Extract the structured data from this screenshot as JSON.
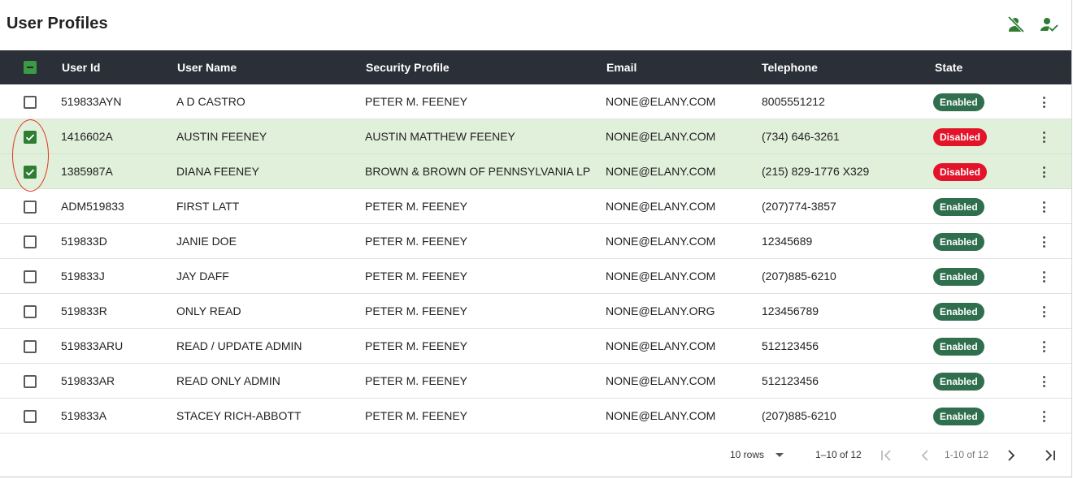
{
  "page": {
    "title": "User Profiles"
  },
  "toolbar": {
    "disable_icon": "person-off-icon",
    "enable_icon": "person-check-icon",
    "icon_color": "#2e7d32"
  },
  "table": {
    "header_bg": "#2b3038",
    "columns": [
      "User Id",
      "User Name",
      "Security Profile",
      "Email",
      "Telephone",
      "State"
    ],
    "rows": [
      {
        "user_id": "519833AYN",
        "user_name": "A D CASTRO",
        "security_profile": "PETER M. FEENEY",
        "email": "NONE@ELANY.COM",
        "telephone": "8005551212",
        "state": "Enabled",
        "selected": false
      },
      {
        "user_id": "1416602A",
        "user_name": "AUSTIN FEENEY",
        "security_profile": "AUSTIN MATTHEW FEENEY",
        "email": "NONE@ELANY.COM",
        "telephone": "(734) 646-3261",
        "state": "Disabled",
        "selected": true
      },
      {
        "user_id": "1385987A",
        "user_name": "DIANA FEENEY",
        "security_profile": "BROWN & BROWN OF PENNSYLVANIA LP",
        "email": "NONE@ELANY.COM",
        "telephone": "(215) 829-1776 X329",
        "state": "Disabled",
        "selected": true
      },
      {
        "user_id": "ADM519833",
        "user_name": "FIRST LATT",
        "security_profile": "PETER M. FEENEY",
        "email": "NONE@ELANY.COM",
        "telephone": "(207)774-3857",
        "state": "Enabled",
        "selected": false
      },
      {
        "user_id": "519833D",
        "user_name": "JANIE DOE",
        "security_profile": "PETER M. FEENEY",
        "email": "NONE@ELANY.COM",
        "telephone": "12345689",
        "state": "Enabled",
        "selected": false
      },
      {
        "user_id": "519833J",
        "user_name": "JAY DAFF",
        "security_profile": "PETER M. FEENEY",
        "email": "NONE@ELANY.COM",
        "telephone": "(207)885-6210",
        "state": "Enabled",
        "selected": false
      },
      {
        "user_id": "519833R",
        "user_name": "ONLY READ",
        "security_profile": "PETER M. FEENEY",
        "email": "NONE@ELANY.ORG",
        "telephone": "123456789",
        "state": "Enabled",
        "selected": false
      },
      {
        "user_id": "519833ARU",
        "user_name": "READ / UPDATE ADMIN",
        "security_profile": "PETER M. FEENEY",
        "email": "NONE@ELANY.COM",
        "telephone": "512123456",
        "state": "Enabled",
        "selected": false
      },
      {
        "user_id": "519833AR",
        "user_name": "READ ONLY ADMIN",
        "security_profile": "PETER M. FEENEY",
        "email": "NONE@ELANY.COM",
        "telephone": "512123456",
        "state": "Enabled",
        "selected": false
      },
      {
        "user_id": "519833A",
        "user_name": "STACEY RICH-ABBOTT",
        "security_profile": "PETER M. FEENEY",
        "email": "NONE@ELANY.COM",
        "telephone": "(207)885-6210",
        "state": "Enabled",
        "selected": false
      }
    ],
    "state_colors": {
      "Enabled": "#2f6f4e",
      "Disabled": "#e3132a"
    },
    "selected_row_color": "#e1f0db",
    "row_menu_icon": "more-vert-icon"
  },
  "footer": {
    "rows_per_page": "10 rows",
    "range": "1–10 of 12",
    "range_secondary": "1-10 of 12",
    "first_icon": "first-page-icon",
    "prev_icon": "chevron-left-icon",
    "next_icon": "chevron-right-icon",
    "last_icon": "last-page-icon"
  }
}
